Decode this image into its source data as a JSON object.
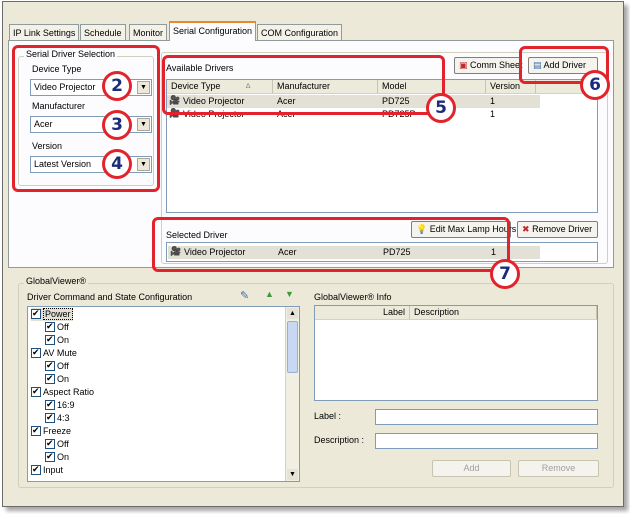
{
  "tabs": [
    {
      "label": "IP Link Settings"
    },
    {
      "label": "Schedule"
    },
    {
      "label": "Monitor"
    },
    {
      "label": "Serial Configuration"
    },
    {
      "label": "COM Configuration"
    }
  ],
  "serial_driver_selection": {
    "legend": "Serial Driver Selection",
    "device_type_label": "Device Type",
    "device_type_value": "Video Projector",
    "manufacturer_label": "Manufacturer",
    "manufacturer_value": "Acer",
    "version_label": "Version",
    "version_value": "Latest Version"
  },
  "available_drivers": {
    "title": "Available Drivers",
    "comm_sheet_label": "Comm Sheet",
    "add_driver_label": "Add Driver",
    "columns": [
      "Device Type",
      "Manufacturer",
      "Model",
      "Version"
    ],
    "rows": [
      {
        "device_type": "Video Projector",
        "manufacturer": "Acer",
        "model": "PD725",
        "version": "1"
      },
      {
        "device_type": "Video Projector",
        "manufacturer": "Acer",
        "model": "PD725P",
        "version": "1"
      }
    ]
  },
  "selected_driver": {
    "title": "Selected Driver",
    "edit_lamp_label": "Edit Max Lamp Hours",
    "remove_driver_label": "Remove Driver",
    "row": {
      "device_type": "Video Projector",
      "manufacturer": "Acer",
      "model": "PD725",
      "version": "1"
    }
  },
  "globalviewer": {
    "legend": "GlobalViewer®",
    "driver_config_title": "Driver Command and State Configuration",
    "tree": [
      {
        "label": "Power",
        "level": 0
      },
      {
        "label": "Off",
        "level": 1
      },
      {
        "label": "On",
        "level": 1
      },
      {
        "label": "AV Mute",
        "level": 0
      },
      {
        "label": "Off",
        "level": 1
      },
      {
        "label": "On",
        "level": 1
      },
      {
        "label": "Aspect Ratio",
        "level": 0
      },
      {
        "label": "16:9",
        "level": 1
      },
      {
        "label": "4:3",
        "level": 1
      },
      {
        "label": "Freeze",
        "level": 0
      },
      {
        "label": "Off",
        "level": 1
      },
      {
        "label": "On",
        "level": 1
      },
      {
        "label": "Input",
        "level": 0
      }
    ],
    "info_title": "GlobalViewer® Info",
    "info_columns": [
      "Label",
      "Description"
    ],
    "label_field_label": "Label :",
    "description_field_label": "Description :",
    "label_value": "",
    "description_value": "",
    "add_label": "Add",
    "remove_label": "Remove"
  },
  "callouts": [
    "2",
    "3",
    "4",
    "5",
    "6",
    "7"
  ],
  "colors": {
    "callout_red": "#e2232b",
    "callout_text": "#1a2c7a",
    "tab_active_accent": "#e68b2c"
  }
}
